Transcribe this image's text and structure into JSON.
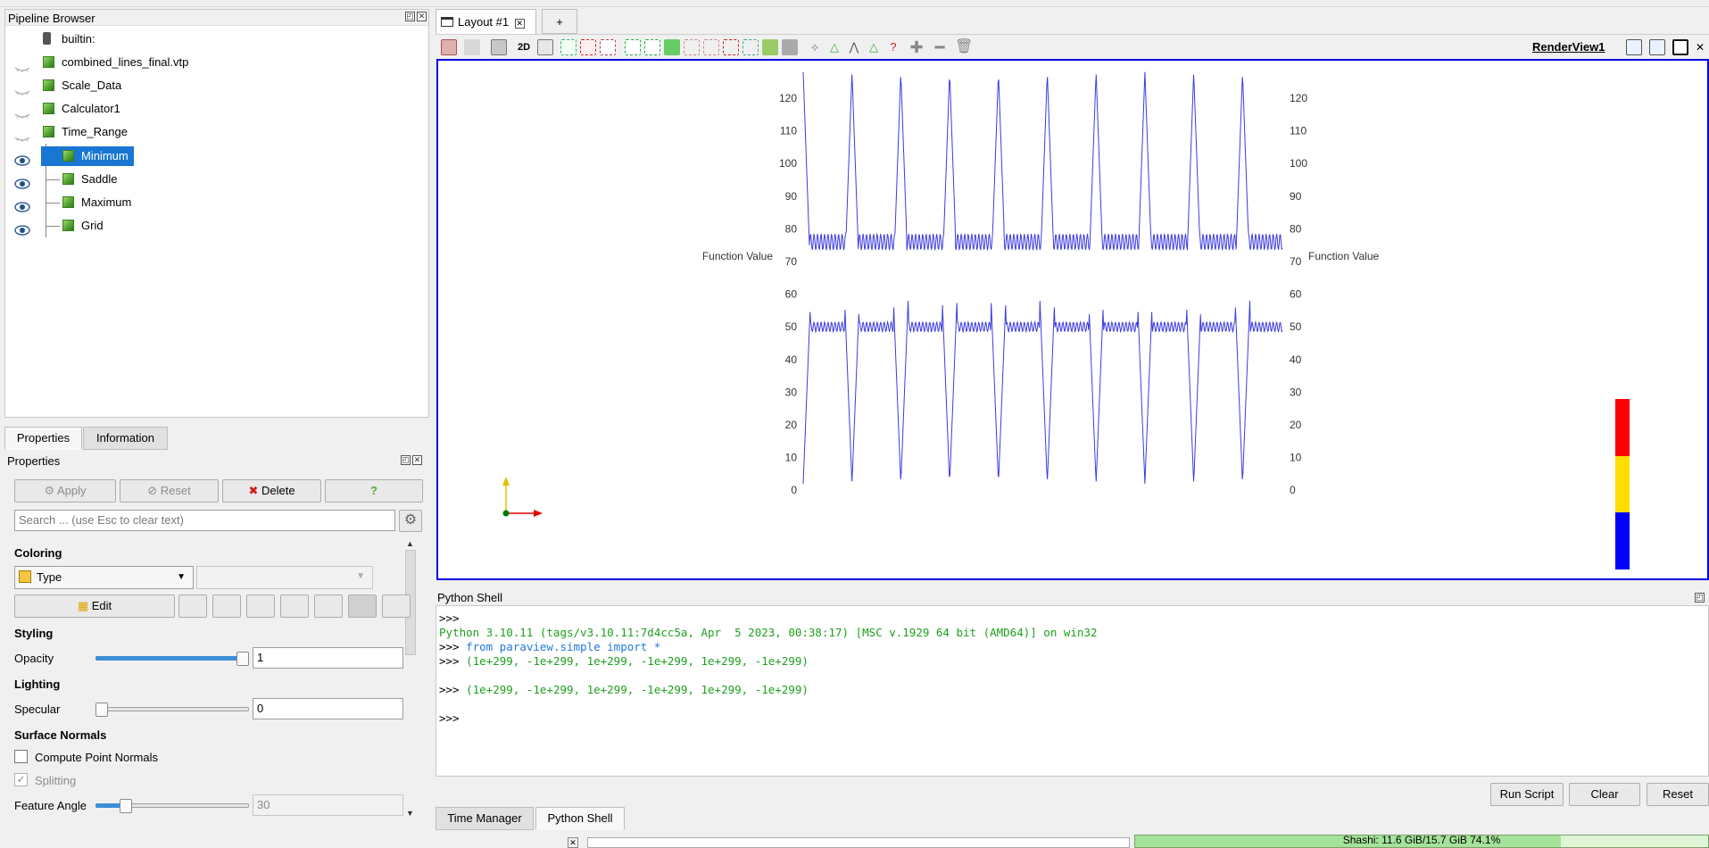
{
  "pipeline": {
    "title": "Pipeline Browser",
    "items": [
      {
        "label": "builtin:",
        "level": 0,
        "eye": "none",
        "icon": "server"
      },
      {
        "label": "combined_lines_final.vtp",
        "level": 0,
        "eye": "closed"
      },
      {
        "label": "Scale_Data",
        "level": 0,
        "eye": "closed"
      },
      {
        "label": "Calculator1",
        "level": 0,
        "eye": "closed"
      },
      {
        "label": "Time_Range",
        "level": 0,
        "eye": "closed"
      },
      {
        "label": "Minimum",
        "level": 1,
        "eye": "open",
        "selected": true
      },
      {
        "label": "Saddle",
        "level": 1,
        "eye": "open"
      },
      {
        "label": "Maximum",
        "level": 1,
        "eye": "open"
      },
      {
        "label": "Grid",
        "level": 1,
        "eye": "open"
      }
    ]
  },
  "lower_tabs": {
    "properties": "Properties",
    "information": "Information"
  },
  "properties": {
    "title": "Properties",
    "apply": "Apply",
    "reset": "Reset",
    "delete": "Delete",
    "help": "?",
    "search_placeholder": "Search ... (use Esc to clear text)",
    "coloring": {
      "section": "Coloring",
      "type_value": "Type",
      "secondary_value": "",
      "edit": "Edit"
    },
    "styling": {
      "section": "Styling",
      "opacity_label": "Opacity",
      "opacity_value": "1",
      "opacity_level": 1.0
    },
    "lighting": {
      "section": "Lighting",
      "specular_label": "Specular",
      "specular_value": "0",
      "specular_level": 0.0
    },
    "surface_normals": {
      "section": "Surface Normals",
      "compute_point_normals": "Compute Point Normals",
      "compute_checked": false,
      "splitting": "Splitting",
      "splitting_checked": true,
      "feature_angle_label": "Feature Angle",
      "feature_angle_value": "30",
      "feature_angle_level": 0.17
    }
  },
  "layout": {
    "tab_label": "Layout #1",
    "add_tab": "+",
    "view_label": "RenderView1",
    "mode_2d": "2D"
  },
  "render": {
    "axis_ticks": [
      "120",
      "110",
      "100",
      "90",
      "80",
      "70",
      "60",
      "50",
      "40",
      "30",
      "20",
      "10",
      "0"
    ],
    "left_axis_label": "Function Value",
    "right_axis_label": "Function Value",
    "colorbar": [
      "#ff0000",
      "#ffdd00",
      "#0000ff"
    ]
  },
  "shell": {
    "title": "Python Shell",
    "lines": [
      {
        "text": ">>>",
        "color": "black"
      },
      {
        "text": "Python 3.10.11 (tags/v3.10.11:7d4cc5a, Apr  5 2023, 00:38:17) [MSC v.1929 64 bit (AMD64)] on win32",
        "color": "green"
      },
      {
        "prompt": ">>> ",
        "text": "from paraview.simple import *",
        "color": "blue"
      },
      {
        "prompt": ">>> ",
        "text": "(1e+299, -1e+299, 1e+299, -1e+299, 1e+299, -1e+299)",
        "color": "green"
      },
      {
        "text": "",
        "color": "black"
      },
      {
        "prompt": ">>> ",
        "text": "(1e+299, -1e+299, 1e+299, -1e+299, 1e+299, -1e+299)",
        "color": "green"
      },
      {
        "text": "",
        "color": "black"
      },
      {
        "text": ">>>",
        "color": "black"
      }
    ],
    "run_script": "Run Script",
    "clear": "Clear",
    "reset": "Reset"
  },
  "bottom_tabs": {
    "time_manager": "Time Manager",
    "python_shell": "Python Shell"
  },
  "status": {
    "memory": "Shashi: 11.6 GiB/15.7 GiB 74.1%",
    "memory_fraction": 0.741
  }
}
